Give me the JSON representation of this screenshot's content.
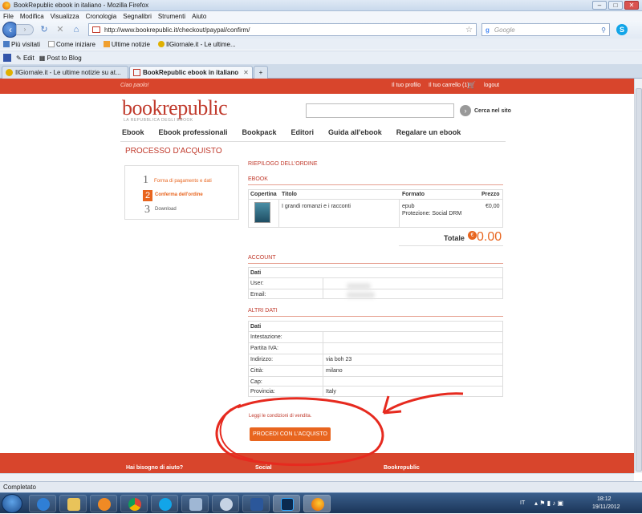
{
  "window": {
    "title": "BookRepublic ebook in italiano - Mozilla Firefox",
    "min": "–",
    "max": "□",
    "close": "✕"
  },
  "menu": [
    "File",
    "Modifica",
    "Visualizza",
    "Cronologia",
    "Segnalibri",
    "Strumenti",
    "Aiuto"
  ],
  "nav": {
    "url": "http://www.bookrepublic.it/checkout/paypal/confirm/",
    "search_placeholder": "Google"
  },
  "bookmarks": [
    "Più visitati",
    "Come iniziare",
    "Ultime notizie",
    "IlGiornale.it - Le ultime..."
  ],
  "toolbar": {
    "edit": "Edit",
    "post": "Post to Blog"
  },
  "tabs": [
    {
      "label": "IlGiornale.it - Le ultime notizie su at...",
      "active": false
    },
    {
      "label": "BookRepublic ebook in italiano",
      "active": true
    }
  ],
  "site": {
    "greeting": "Ciao paolo!",
    "links": [
      "Il tuo profilo",
      "Il tuo carrello (1)",
      "logout"
    ],
    "logo": "bookrepublic",
    "logo_sub": "LA REPUBBLICA DEGLI EBOOK",
    "search_label": "Cerca nel sito",
    "categories": [
      "Ebook",
      "Ebook professionali",
      "Bookpack",
      "Editori",
      "Guida all'ebook",
      "Regalare un ebook"
    ]
  },
  "checkout": {
    "title": "PROCESSO D'ACQUISTO",
    "steps": [
      {
        "num": "1",
        "label": "Forma di pagamento e dati"
      },
      {
        "num": "2",
        "label": "Conferma dell'ordine"
      },
      {
        "num": "3",
        "label": "Download"
      }
    ],
    "summary_title": "RIEPILOGO DELL'ORDINE",
    "ebook_title": "EBOOK",
    "table_headers": [
      "Copertina",
      "Titolo",
      "Formato",
      "Prezzo"
    ],
    "item": {
      "title": "I grandi romanzi e i racconti",
      "format": "epub",
      "protection": "Protezione: Social DRM",
      "price": "€0,00"
    },
    "total_label": "Totale",
    "total_euro": "€",
    "total_value": "0.00",
    "account_title": "ACCOUNT",
    "account_heading": "Dati",
    "account_fields": [
      {
        "label": "User:"
      },
      {
        "label": "Email:"
      }
    ],
    "other_title": "ALTRI DATI",
    "other_heading": "Dati",
    "other_fields": [
      {
        "label": "Intestazione:",
        "value": ""
      },
      {
        "label": "Partita IVA:",
        "value": ""
      },
      {
        "label": "Indirizzo:",
        "value": "via boh 23"
      },
      {
        "label": "Città:",
        "value": "milano"
      },
      {
        "label": "Cap:",
        "value": ""
      },
      {
        "label": "Provincia:",
        "value": "Italy"
      }
    ],
    "conditions": "Leggi le condizioni di vendita.",
    "proceed": "PROCEDI CON L'ACQUISTO"
  },
  "footer": [
    "Hai bisogno di aiuto?",
    "Social",
    "Bookrepublic"
  ],
  "status": "Completato",
  "tray": {
    "lang": "IT",
    "time": "18:12",
    "date": "19/11/2012"
  }
}
